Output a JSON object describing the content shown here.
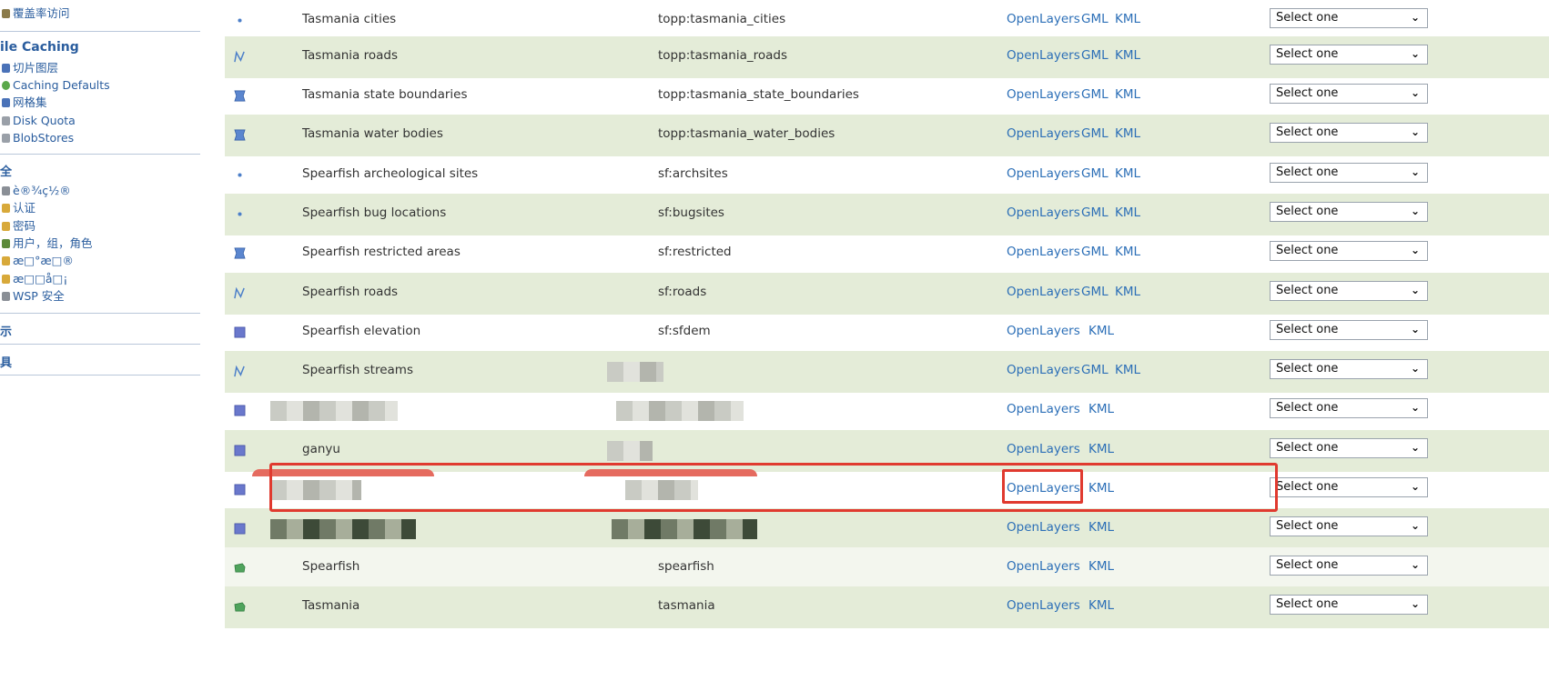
{
  "sidebar": {
    "top_item": "覆盖率访问",
    "sections": [
      {
        "title": "ile Caching",
        "items": [
          "切片图层",
          "Caching Defaults",
          "网格集",
          "Disk Quota",
          "BlobStores"
        ]
      },
      {
        "title": "全",
        "items": [
          "è®¾ç½®",
          "认证",
          "密码",
          "用户，组，角色",
          "æ□°æ□®",
          "æ□□å□¡",
          "WSP 安全"
        ]
      },
      {
        "title": "示",
        "items": []
      },
      {
        "title": "具",
        "items": []
      }
    ]
  },
  "layers": [
    {
      "type_icon": "point-icon",
      "title": "Tasmania cities",
      "name": "topp:tasmania_cities",
      "links": [
        "OpenLayers",
        "GML",
        "KML"
      ],
      "select": "Select one"
    },
    {
      "type_icon": "line-icon",
      "title": "Tasmania roads",
      "name": "topp:tasmania_roads",
      "links": [
        "OpenLayers",
        "GML",
        "KML"
      ],
      "select": "Select one"
    },
    {
      "type_icon": "polygon-icon",
      "title": "Tasmania state boundaries",
      "name": "topp:tasmania_state_boundaries",
      "links": [
        "OpenLayers",
        "GML",
        "KML"
      ],
      "select": "Select one"
    },
    {
      "type_icon": "polygon-icon",
      "title": "Tasmania water bodies",
      "name": "topp:tasmania_water_bodies",
      "links": [
        "OpenLayers",
        "GML",
        "KML"
      ],
      "select": "Select one"
    },
    {
      "type_icon": "point-icon",
      "title": "Spearfish archeological sites",
      "name": "sf:archsites",
      "links": [
        "OpenLayers",
        "GML",
        "KML"
      ],
      "select": "Select one"
    },
    {
      "type_icon": "point-icon",
      "title": "Spearfish bug locations",
      "name": "sf:bugsites",
      "links": [
        "OpenLayers",
        "GML",
        "KML"
      ],
      "select": "Select one"
    },
    {
      "type_icon": "polygon-icon",
      "title": "Spearfish restricted areas",
      "name": "sf:restricted",
      "links": [
        "OpenLayers",
        "GML",
        "KML"
      ],
      "select": "Select one"
    },
    {
      "type_icon": "line-icon",
      "title": "Spearfish roads",
      "name": "sf:roads",
      "links": [
        "OpenLayers",
        "GML",
        "KML"
      ],
      "select": "Select one"
    },
    {
      "type_icon": "raster-icon",
      "title": "Spearfish elevation",
      "name": "sf:sfdem",
      "links": [
        "OpenLayers",
        "KML"
      ],
      "select": "Select one"
    },
    {
      "type_icon": "line-icon",
      "title": "Spearfish streams",
      "name": "",
      "links": [
        "OpenLayers",
        "GML",
        "KML"
      ],
      "select": "Select one"
    },
    {
      "type_icon": "raster-icon",
      "title": "",
      "name": "",
      "links": [
        "OpenLayers",
        "KML"
      ],
      "select": "Select one"
    },
    {
      "type_icon": "raster-icon",
      "title": "ganyu",
      "name": "",
      "links": [
        "OpenLayers",
        "KML"
      ],
      "select": "Select one"
    },
    {
      "type_icon": "raster-icon",
      "title": "",
      "name": "",
      "links": [
        "OpenLayers",
        "KML"
      ],
      "select": "Select one"
    },
    {
      "type_icon": "raster-icon",
      "title": "",
      "name": "",
      "links": [
        "OpenLayers",
        "KML"
      ],
      "select": "Select one"
    },
    {
      "type_icon": "layer-group-icon",
      "title": "Spearfish",
      "name": "spearfish",
      "links": [
        "OpenLayers",
        "KML"
      ],
      "select": "Select one"
    },
    {
      "type_icon": "layer-group-icon",
      "title": "Tasmania",
      "name": "tasmania",
      "links": [
        "OpenLayers",
        "KML"
      ],
      "select": "Select one"
    }
  ],
  "colors": {
    "row_alt": "#e4ecd8",
    "link": "#2c6fb7",
    "highlight": "#e03a2f"
  }
}
